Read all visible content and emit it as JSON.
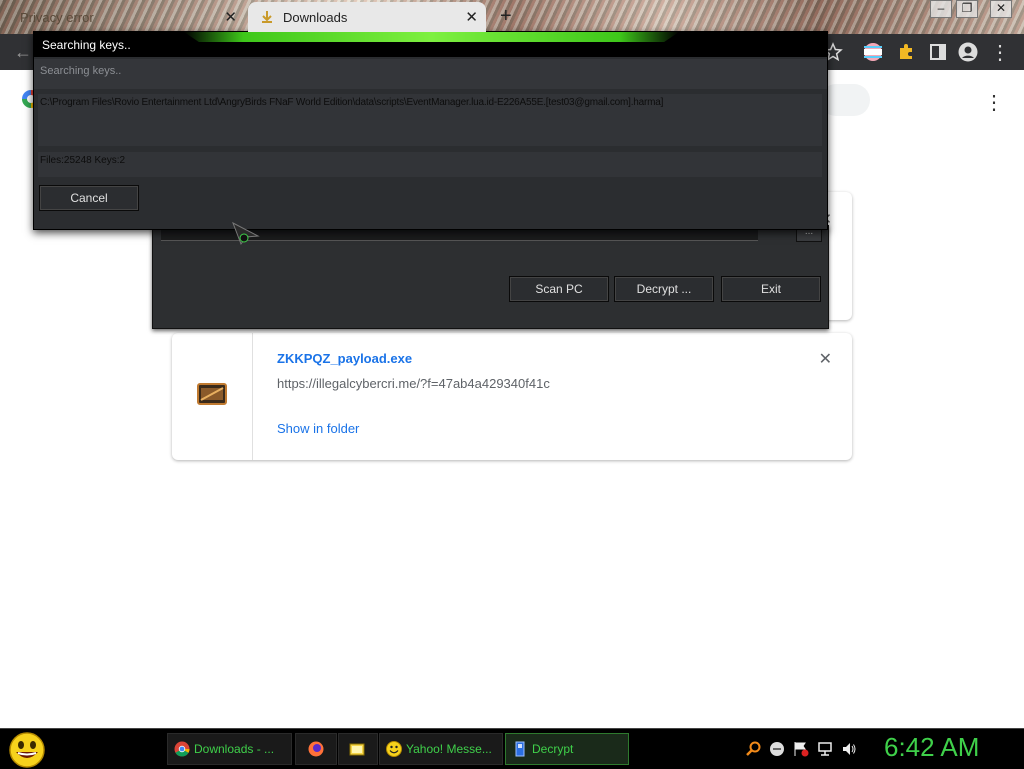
{
  "browser": {
    "tabs": [
      {
        "title": "Privacy error",
        "active": false
      },
      {
        "title": "Downloads",
        "active": true
      }
    ],
    "new_tab_symbol": "+",
    "tab_close_symbol": "✕",
    "window_controls": {
      "minimize": "–",
      "restore": "❐",
      "close": "✕"
    },
    "menu_symbol": "⋮"
  },
  "downloads": {
    "item": {
      "file_name": "ZKKPQZ_payload.exe",
      "url": "https://illegalcybercri.me/?f=47ab4a429340f41c",
      "action_label": "Show in folder",
      "close_symbol": "✕"
    },
    "partial_card_close_symbol": "✕"
  },
  "decrypt_window": {
    "browse_label": "...",
    "buttons": {
      "scan": "Scan PC",
      "decrypt": "Decrypt ...",
      "exit": "Exit"
    }
  },
  "searching_dialog": {
    "title": "Searching keys..",
    "status": "Searching keys..",
    "current_path": "C:\\Program Files\\Rovio Entertainment Ltd\\AngryBirds FNaF World Edition\\data\\scripts\\EventManager.lua.id-E226A55E.[test03@gmail.com].harma]",
    "counts": "Files:25248 Keys:2",
    "cancel_label": "Cancel"
  },
  "taskbar": {
    "tasks": [
      {
        "label": "Downloads - ...",
        "icon": "chrome-icon",
        "active": false
      },
      {
        "label": "",
        "icon": "firefox-icon",
        "active": false
      },
      {
        "label": "",
        "icon": "folder-icon",
        "active": false
      },
      {
        "label": "Yahoo! Messe...",
        "icon": "yahoo-messenger-icon",
        "active": false
      },
      {
        "label": "Decrypt",
        "icon": "decrypt-app-icon",
        "active": true
      }
    ],
    "clock": "6:42 AM",
    "accent_color": "#3fd04a"
  }
}
